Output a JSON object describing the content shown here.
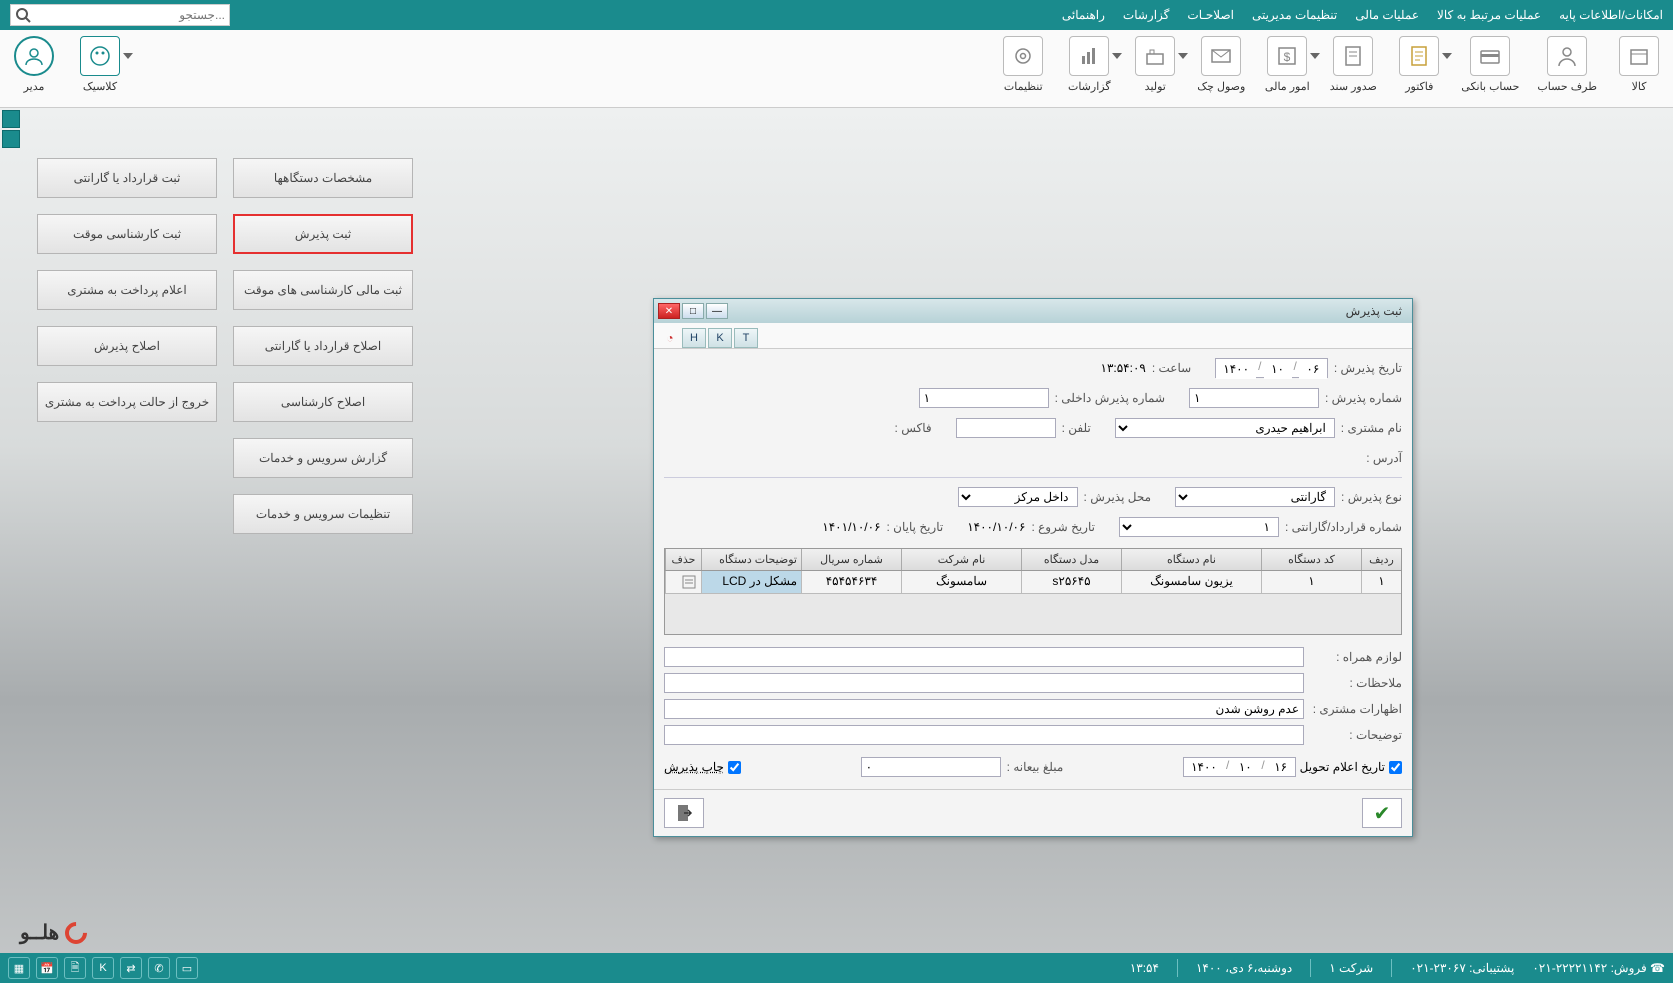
{
  "menubar": {
    "items": [
      "امکانات/اطلاعات پایه",
      "عملیات مرتبط به کالا",
      "عملیات مالی",
      "تنظیمات مدیریتی",
      "اصلاحـات",
      "گزارشات",
      "راهنمائی"
    ],
    "search_placeholder": "جستجو..."
  },
  "toolbar": {
    "right": [
      {
        "label": "کالا"
      },
      {
        "label": "طرف حساب"
      },
      {
        "label": "حساب بانکی"
      },
      {
        "label": "فاکتور"
      },
      {
        "label": "صدور سند"
      },
      {
        "label": "امور مالی"
      },
      {
        "label": "وصول چک"
      },
      {
        "label": "تولید"
      },
      {
        "label": "گزارشات"
      },
      {
        "label": "تنظیمات"
      }
    ],
    "left": [
      {
        "label": "کلاسیک"
      },
      {
        "label": "مدیر"
      }
    ]
  },
  "buttons_col1": [
    "مشخصات دستگاهها",
    "ثبت پذیرش",
    "ثبت مالی کارشناسی های موقت",
    "اصلاح قرارداد یا گارانتی",
    "اصلاح کارشناسی",
    "گزارش سرویس و خدمات",
    "تنظیمات سرویس و خدمات"
  ],
  "buttons_col2": [
    "ثبت قرارداد یا گارانتی",
    "ثبت کارشناسی موقت",
    "اعلام پرداخت به مشتری",
    "اصلاح پذیرش",
    "خروج از حالت پرداخت به مشتری"
  ],
  "dialog": {
    "title": "ثبت پذیرش",
    "tabs": [
      "H",
      "K",
      "T"
    ],
    "labels": {
      "tarikh_paziresh": "تاریخ  پذیرش  :",
      "saat": "ساعت  :",
      "saat_val": "۱۳:۵۴:۰۹",
      "shomare_paziresh": "شماره پذیرش  :",
      "shomare_paziresh_val": "۱",
      "shomare_dakheli": "شماره پذیرش داخلی  :",
      "shomare_dakheli_val": "۱",
      "nam_moshtari": "نام مشتری  :",
      "nam_moshtari_val": "ابراهیم حیدری",
      "telefon": "تلفن  :",
      "fax": "فاکس  :",
      "address": "آدرس  :",
      "noe_paziresh": "نوع پذیرش  :",
      "noe_paziresh_val": "گارانتی",
      "mahal_paziresh": "محل پذیرش  :",
      "mahal_paziresh_val": "داخل مرکز",
      "shomare_gharardad": "شماره قرارداد/گارانتی  :",
      "shomare_gharardad_val": "۱",
      "tarikh_shoroo": "تاریخ شروع  :",
      "tarikh_shoroo_val": "۱۴۰۰/۱۰/۰۶",
      "tarikh_payan": "تاریخ پایان  :",
      "tarikh_payan_val": "۱۴۰۱/۱۰/۰۶",
      "date_d": "۰۶",
      "date_m": "۱۰",
      "date_y": "۱۴۰۰"
    },
    "grid": {
      "headers": [
        "ردیف",
        "کد دستگاه",
        "نام دستگاه",
        "مدل دستگاه",
        "نام شرکت",
        "شماره سریال",
        "توضیحات دستگاه",
        "حذف"
      ],
      "row": {
        "radif": "۱",
        "code": "۱",
        "name": "یزیون سامسونگ",
        "model": "s۲۵۶۴۵",
        "company": "سامسونگ",
        "serial": "۴۵۴۵۴۶۳۴",
        "desc": "مشکل در LCD"
      }
    },
    "bottom": {
      "lavazem": "لوازم همراه  :",
      "molahezat": "ملاحظات  :",
      "ezharat": "اظهارات مشتری  :",
      "ezharat_val": "عدم روشن شدن",
      "tozihat": "توضیحات  :",
      "tarikh_elam": "تاریخ اعلام تحویل",
      "tarikh_elam_d": "۱۶",
      "tarikh_elam_m": "۱۰",
      "tarikh_elam_y": "۱۴۰۰",
      "mablagh_beyane": "مبلغ بیعانه  :",
      "mablagh_val": "۰",
      "chap_paziresh": "چاپ پذیرش"
    }
  },
  "logo_text": "هلــو",
  "statusbar": {
    "time": "۱۳:۵۴",
    "date": "دوشنبه،۶ دی، ۱۴۰۰",
    "sherkat": "شرکت ۱",
    "poshtibani": "پشتیبانی:  ۲۳۰۶۷-۰۲۱",
    "forosh": "فروش:  ۲۲۲۲۱۱۴۲-۰۲۱",
    "k": "K"
  }
}
